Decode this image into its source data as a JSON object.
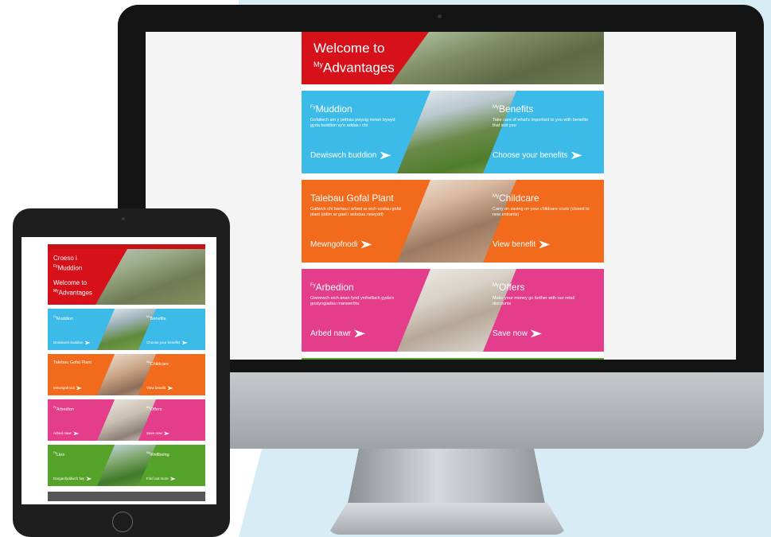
{
  "colors": {
    "red": "#d6111a",
    "blue": "#3dbbe8",
    "orange": "#f26a1b",
    "pink": "#e43d8c",
    "green": "#56a329",
    "background_accent": "#d8ecf6"
  },
  "desktop": {
    "hero": {
      "line1": "Welcome to",
      "prefix": "My",
      "line2": "Advantages"
    },
    "cards": [
      {
        "left_prefix": "Fy",
        "left_title": "Muddion",
        "left_desc": "Gofalwch am y pethau pwysig mewn bywyd gyda buddion sy'n addas i chi",
        "left_cta": "Dewiswch buddion",
        "right_prefix": "My",
        "right_title": "Benefits",
        "right_desc": "Take care of what's important to you with benefits that suit you",
        "right_cta": "Choose your benefits"
      },
      {
        "left_prefix": "",
        "left_title": "Talebau Gofal Plant",
        "left_desc": "Gallwch chi barhau i arbed ar eich costau gofal plant (ddim ar gael i aelodau newydd)",
        "left_cta": "Mewngofnodi",
        "right_prefix": "My",
        "right_title": "Childcare",
        "right_desc": "Carry on saving on your childcare costs (closed to new entrants)",
        "right_cta": "View benefit"
      },
      {
        "left_prefix": "Fy",
        "left_title": "Arbedion",
        "left_desc": "Gwnewch eich arian fynd ymhellach gyda'n gostyngiadau manwerthu",
        "left_cta": "Arbed nawr",
        "right_prefix": "My",
        "right_title": "Offers",
        "right_desc": "Make your money go further with our retail discounts",
        "right_cta": "Save now"
      }
    ]
  },
  "tablet": {
    "hero": {
      "welsh_line1": "Croeso i",
      "welsh_prefix": "Fy",
      "welsh_line2": "Muddion",
      "english_line1": "Welcome to",
      "english_prefix": "My",
      "english_line2": "Advantages"
    },
    "cards": [
      {
        "left_prefix": "Fy",
        "left_title": "Muddion",
        "left_cta": "Dewiswch buddion",
        "right_prefix": "My",
        "right_title": "Benefits",
        "right_cta": "Choose your benefits"
      },
      {
        "left_prefix": "",
        "left_title": "Talebau Gofal Plant",
        "left_cta": "Mewngofnodi",
        "right_prefix": "My",
        "right_title": "Childcare",
        "right_cta": "View benefit"
      },
      {
        "left_prefix": "Fy",
        "left_title": "Arbedion",
        "left_cta": "Arbed nawr",
        "right_prefix": "My",
        "right_title": "Offers",
        "right_cta": "Save now"
      },
      {
        "left_prefix": "Fy",
        "left_title": "Lles",
        "left_cta": "Darganfyddwch fwy",
        "right_prefix": "My",
        "right_title": "Wellbeing",
        "right_cta": "Find out more"
      }
    ]
  }
}
